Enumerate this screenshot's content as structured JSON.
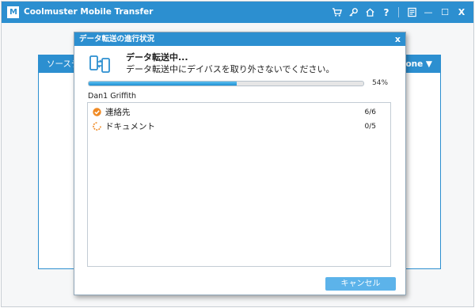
{
  "app": {
    "title": "Coolmuster Mobile Transfer",
    "logo_text": "M",
    "accent_color": "#2c8fd0",
    "toolbar_icons": [
      "cart-icon",
      "key-icon",
      "home-icon",
      "help-icon",
      "feedback-icon",
      "minimize-icon",
      "maximize-icon",
      "close-icon"
    ],
    "toolbar_glyphs": {
      "help": "?",
      "minimize": "—",
      "maximize": "☐",
      "close": "X"
    }
  },
  "background_panel": {
    "source_label": "ソースデ",
    "device_label": "one ▼"
  },
  "dialog": {
    "title": "データ転送の進行状況",
    "close_label": "x",
    "status_title": "データ転送中...",
    "status_message": "データ転送中にデイバスを取り外さないでください。",
    "progress_percent": 54,
    "progress_label": "54%",
    "device_name": "Dan1 Griffith",
    "items": [
      {
        "label": "連絡先",
        "count": "6/6",
        "state": "done",
        "icon": "check-circle-icon"
      },
      {
        "label": "ドキュメント",
        "count": "0/5",
        "state": "in-progress",
        "icon": "spinner-icon"
      }
    ],
    "cancel_label": "キャンセル"
  }
}
